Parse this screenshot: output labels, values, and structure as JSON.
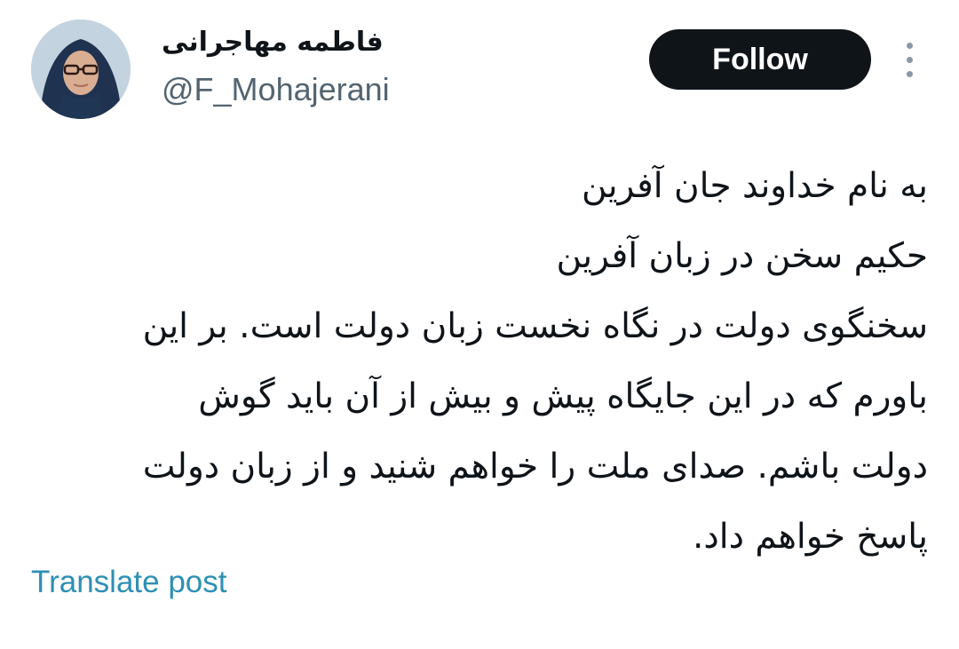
{
  "author": {
    "display_name": "فاطمه مهاجرانی",
    "handle": "@F_Mohajerani"
  },
  "actions": {
    "follow_label": "Follow",
    "more_icon": "more-vertical-icon"
  },
  "post": {
    "lines": [
      "به نام خداوند جان آفرین",
      "حکیم سخن در زبان آفرین",
      "سخنگوی دولت در نگاه نخست زبان دولت است. بر این",
      "باورم که در این جایگاه پیش و بیش از آن باید گوش",
      "دولت باشم. صدای ملت را خواهم شنید و از زبان دولت",
      "پاسخ خواهم داد."
    ]
  },
  "footer": {
    "translate_label": "Translate post"
  },
  "colors": {
    "follow_bg": "#0f1419",
    "link": "#2e8fb5",
    "secondary_text": "#536471"
  }
}
